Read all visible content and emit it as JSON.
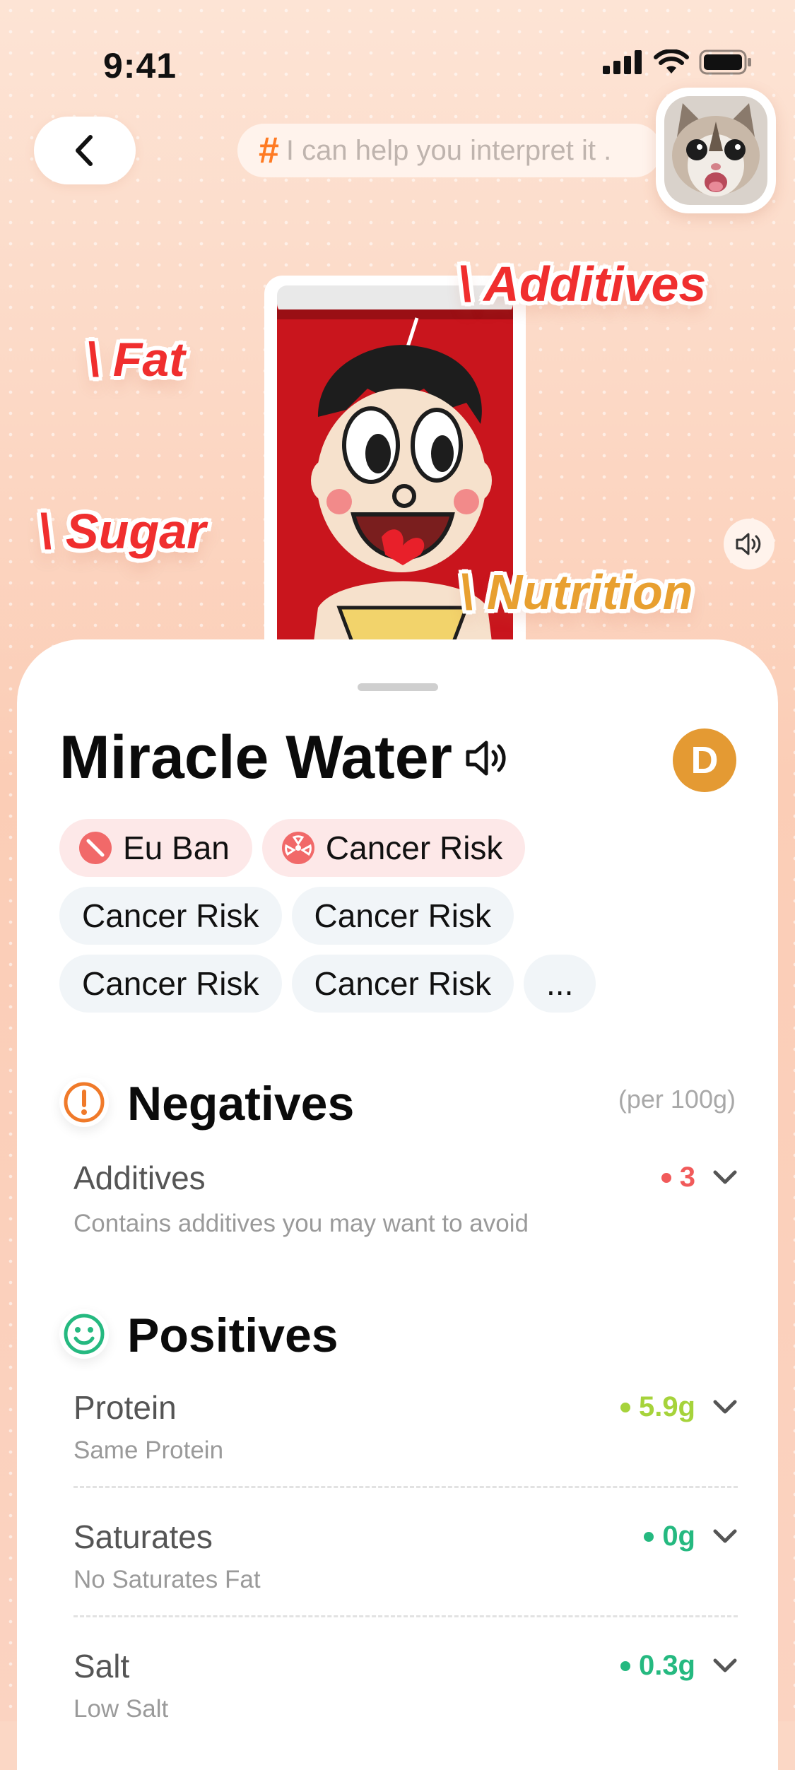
{
  "status": {
    "time": "9:41"
  },
  "header": {
    "ask_hash": "#",
    "ask_text": "I can help you interpret it ."
  },
  "tags": {
    "additives": "\\ Additives",
    "fat": "\\ Fat",
    "sugar": "\\ Sugar",
    "nutrition": "\\ Nutrition"
  },
  "product": {
    "title": "Miracle Water",
    "grade": "D",
    "chips": [
      {
        "label": "Eu Ban",
        "kind": "warn",
        "icon": "ban-icon"
      },
      {
        "label": "Cancer Risk",
        "kind": "warn",
        "icon": "hazard-icon"
      },
      {
        "label": "Cancer Risk",
        "kind": "plain"
      },
      {
        "label": "Cancer Risk",
        "kind": "plain"
      },
      {
        "label": "Cancer Risk",
        "kind": "plain"
      },
      {
        "label": "Cancer Risk",
        "kind": "plain"
      },
      {
        "label": "...",
        "kind": "plain"
      }
    ]
  },
  "negatives": {
    "title": "Negatives",
    "per": "(per 100g)",
    "items": [
      {
        "name": "Additives",
        "desc": "Contains additives you may want to avoid",
        "value": "3",
        "color": "#f15a5a"
      }
    ]
  },
  "positives": {
    "title": "Positives",
    "items": [
      {
        "name": "Protein",
        "desc": "Same Protein",
        "value": "5.9g",
        "color": "#a6d33b"
      },
      {
        "name": "Saturates",
        "desc": "No Saturates Fat",
        "value": "0g",
        "color": "#25b980"
      },
      {
        "name": "Salt",
        "desc": "Low Salt",
        "value": "0.3g",
        "color": "#25b980"
      }
    ]
  },
  "colors": {
    "accent": "#ff7a22",
    "grade": "#e49a33",
    "negative": "#f15a5a",
    "positive": "#25b980"
  }
}
